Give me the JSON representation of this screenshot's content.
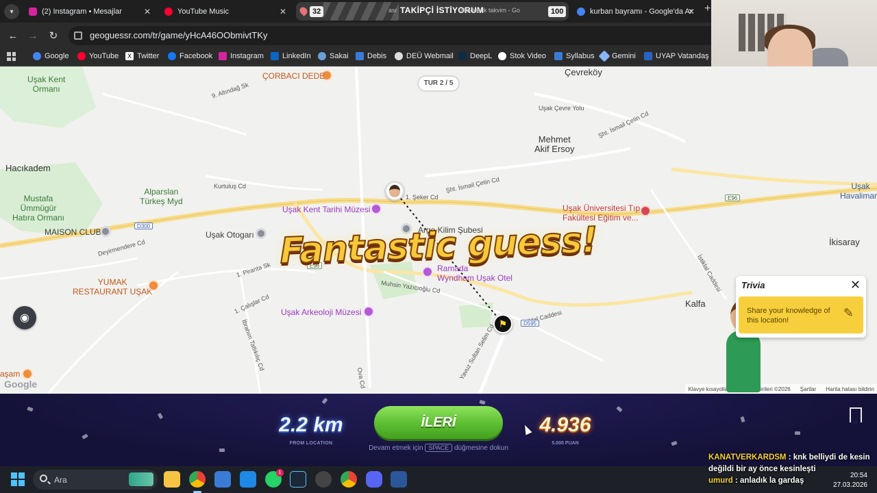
{
  "browser": {
    "tabs": [
      {
        "label": "(2) Instagram • Mesajlar",
        "color": "#d6249f"
      },
      {
        "label": "YouTube Music",
        "color": "#ff0033"
      },
      {
        "label": "akademik takvim - Go",
        "color": "#4285f4"
      },
      {
        "label": "kurban bayramı - Google'da Ar",
        "color": "#4285f4"
      }
    ],
    "tab_group_count": "32",
    "tab_group_overlay": "TAKİPÇİ İSTİYORUM",
    "tab_group_small": "asr",
    "tab_group_count2": "100",
    "url": "geoguessr.com/tr/game/yHcA46OObmivtTKy",
    "bookmarks": [
      {
        "label": "Google",
        "color": "#4285f4"
      },
      {
        "label": "YouTube",
        "color": "#ff0033"
      },
      {
        "label": "Twitter",
        "color": "#ffffff"
      },
      {
        "label": "Facebook",
        "color": "#1877f2"
      },
      {
        "label": "Instagram",
        "color": "#d6249f"
      },
      {
        "label": "LinkedIn",
        "color": "#0a66c2"
      },
      {
        "label": "Sakai",
        "color": "#6aa0d8"
      },
      {
        "label": "Debis",
        "color": "#3a7bd5"
      },
      {
        "label": "DEÜ Webmail",
        "color": "#dddddd"
      },
      {
        "label": "DeepL",
        "color": "#0f2b46"
      },
      {
        "label": "Stok Video",
        "color": "#ffffff"
      },
      {
        "label": "Syllabus",
        "color": "#3a7bd5"
      },
      {
        "label": "Gemini",
        "color": "#8ab4f8"
      },
      {
        "label": "UYAP Vatandaş",
        "color": "#2a63c6"
      }
    ]
  },
  "map": {
    "round": "TUR 2 / 5",
    "banner": "Fantastic guess!",
    "labels": {
      "usak_kent_ormani": "Uşak Kent\nOrmanı",
      "corbaci_dede": "ÇORBACI DEDE",
      "cevrekoy": "Çevreköy",
      "altindag": "9. Altındağ Sk",
      "mehmet_akif": "Mehmet\nAkif Ersoy",
      "hacikadem": "Hacıkadem",
      "alparslan": "Alparslan\nTürkeş Myd",
      "mustafa": "Mustafa\nÜmmügür\nHatıra Ormanı",
      "kent_tarihi": "Uşak Kent Tarihi Müzesi",
      "usak_uni": "Uşak Üniversitesi Tıp\nFakültesi Eğitim ve...",
      "maison": "MAISON CLUB",
      "otogari": "Uşak Otogarı",
      "argo": "Argo Kilim Şubesi",
      "ramada": "Ramada\nWyndham Uşak Otel",
      "ikisaray": "İkisaray",
      "usak_havalimani": "Uşak\nHavalimanı",
      "yumak": "YUMAK\nRESTAURANT UŞAK",
      "arkeoloji": "Uşak Arkeoloji Müzesi",
      "kalfa": "Kalfa",
      "asam": "aşam",
      "istiklal": "İstiklal Caddesi",
      "muhsin": "Muhsin Yazıcıoğlu Cd",
      "sehit_ismail": "Şht. İsmail Çetin Cd",
      "usak_cevre": "Uşak Çevre Yolu",
      "denizli": "Deyirmendere Cd",
      "piranta": "1. Piranta Sk",
      "caliscar": "1. Çalışlar Cd",
      "ibrahim": "İbrahim Tatlıkılıç Cd",
      "ova": "Ova Cd",
      "kurtulus": "Kurtuluş Cd",
      "seker": "1. Şeker Cd",
      "sultan": "Yavuz Sultan Selim Cd",
      "d300": "D300",
      "e96a": "E96",
      "e96b": "E96",
      "d595": "D595"
    },
    "google": "Google",
    "attribution": [
      "Klavye kısayolları",
      "Harita verileri ©2026",
      "Şartlar",
      "Harita hatası bildirin"
    ]
  },
  "trivia": {
    "title": "Trivia",
    "text": "Share your knowledge of this location!"
  },
  "result": {
    "distance": "2.2 km",
    "distance_sub": "FROM LOCATION",
    "next_label": "İLERİ",
    "hint_pre": "Devam etmek için",
    "hint_key": "SPACE",
    "hint_post": "düğmesine dokun",
    "score": "4.936",
    "score_sub": "5.000 PUAN"
  },
  "taskbar": {
    "search_label": "Ara",
    "notification_badge": "1",
    "time": "20:54",
    "date": "27.03.2026"
  },
  "chat": [
    {
      "user": "KANATVERKARDSM",
      "message": "knk belliydi de kesin değildi bir ay önce kesinleşti"
    },
    {
      "user": "umurd",
      "message": "anladık la gardaş"
    }
  ]
}
